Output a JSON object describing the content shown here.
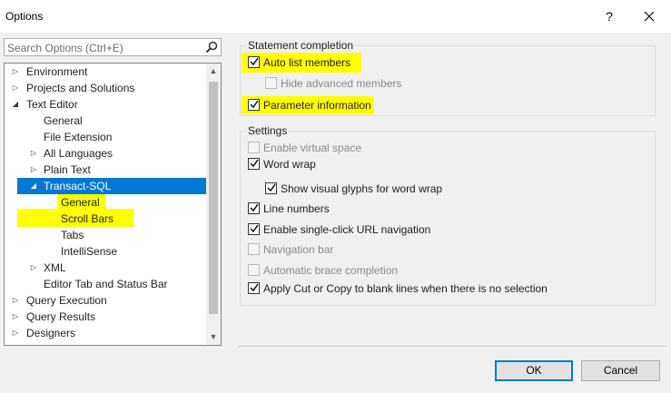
{
  "window": {
    "title": "Options",
    "help_label": "?"
  },
  "search": {
    "placeholder": "Search Options (Ctrl+E)"
  },
  "tree": {
    "items": [
      {
        "label": "Environment",
        "expander": "collapsed",
        "level": 0
      },
      {
        "label": "Projects and Solutions",
        "expander": "collapsed",
        "level": 0
      },
      {
        "label": "Text Editor",
        "expander": "expanded",
        "level": 0
      },
      {
        "label": "General",
        "expander": "none",
        "level": 1
      },
      {
        "label": "File Extension",
        "expander": "none",
        "level": 1
      },
      {
        "label": "All Languages",
        "expander": "collapsed",
        "level": 1
      },
      {
        "label": "Plain Text",
        "expander": "collapsed",
        "level": 1
      },
      {
        "label": "Transact-SQL",
        "expander": "expanded",
        "level": 1,
        "selected": true
      },
      {
        "label": "General",
        "expander": "none",
        "level": 2
      },
      {
        "label": "Scroll Bars",
        "expander": "none",
        "level": 2
      },
      {
        "label": "Tabs",
        "expander": "none",
        "level": 2
      },
      {
        "label": "IntelliSense",
        "expander": "none",
        "level": 2
      },
      {
        "label": "XML",
        "expander": "collapsed",
        "level": 1
      },
      {
        "label": "Editor Tab and Status Bar",
        "expander": "none",
        "level": 1
      },
      {
        "label": "Query Execution",
        "expander": "collapsed",
        "level": 0
      },
      {
        "label": "Query Results",
        "expander": "collapsed",
        "level": 0
      },
      {
        "label": "Designers",
        "expander": "collapsed",
        "level": 0
      }
    ]
  },
  "statement_completion": {
    "title": "Statement completion",
    "auto_list_members": {
      "label": "Auto list members",
      "checked": true,
      "enabled": true
    },
    "hide_advanced_members": {
      "label": "Hide advanced members",
      "checked": false,
      "enabled": false
    },
    "parameter_information": {
      "label": "Parameter information",
      "checked": true,
      "enabled": true
    }
  },
  "settings": {
    "title": "Settings",
    "enable_virtual_space": {
      "label": "Enable virtual space",
      "checked": false,
      "enabled": false
    },
    "word_wrap": {
      "label": "Word wrap",
      "checked": true,
      "enabled": true
    },
    "show_visual_glyphs": {
      "label": "Show visual glyphs for word wrap",
      "checked": true,
      "enabled": true
    },
    "line_numbers": {
      "label": "Line numbers",
      "checked": true,
      "enabled": true
    },
    "single_click_url": {
      "label": "Enable single-click URL navigation",
      "checked": true,
      "enabled": true
    },
    "navigation_bar": {
      "label": "Navigation bar",
      "checked": false,
      "enabled": false
    },
    "automatic_brace_completion": {
      "label": "Automatic brace completion",
      "checked": false,
      "enabled": false
    },
    "apply_cut_copy": {
      "label": "Apply Cut or Copy to blank lines when there is no selection",
      "checked": true,
      "enabled": true
    }
  },
  "buttons": {
    "ok_label": "OK",
    "cancel_label": "Cancel"
  },
  "colors": {
    "selection": "#0078d7",
    "highlight": "#ffff00",
    "default_button_border": "#0078d7"
  }
}
